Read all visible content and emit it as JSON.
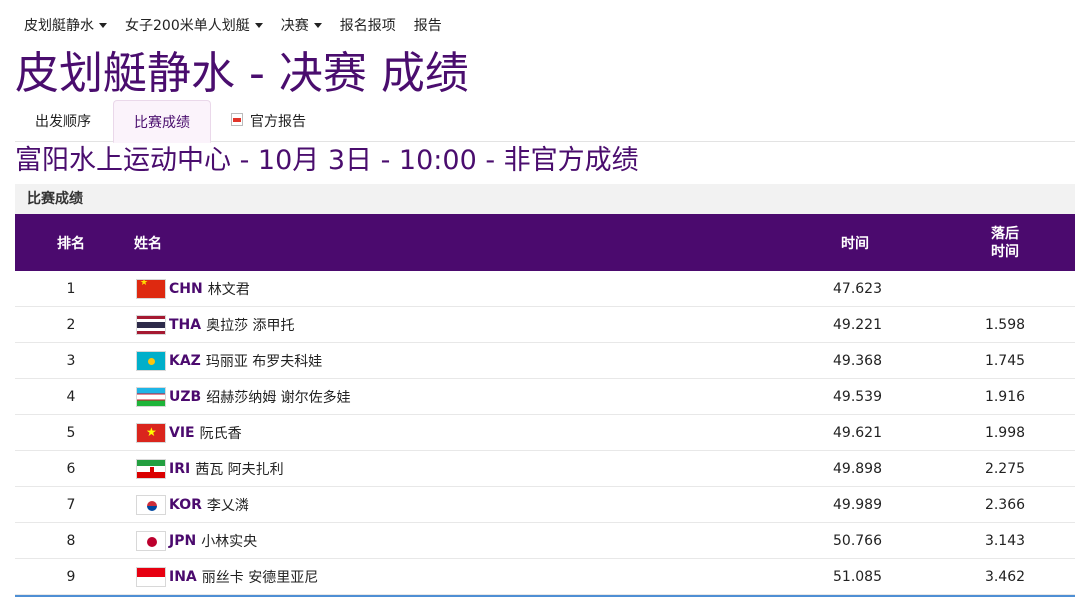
{
  "breadcrumbs": [
    {
      "label": "皮划艇静水",
      "dropdown": true
    },
    {
      "label": "女子200米单人划艇",
      "dropdown": true
    },
    {
      "label": "决赛",
      "dropdown": true
    },
    {
      "label": "报名报项",
      "dropdown": false
    },
    {
      "label": "报告",
      "dropdown": false
    }
  ],
  "page_title": "皮划艇静水 - 决赛 成绩",
  "tabs": {
    "start_list": "出发顺序",
    "results": "比赛成绩",
    "official_report": "官方报告",
    "active": "results"
  },
  "subtitle": "富阳水上运动中心 - 10月 3日 - 10:00 - 非官方成绩",
  "section_label": "比赛成绩",
  "table": {
    "headers": {
      "rank": "排名",
      "name": "姓名",
      "time": "时间",
      "behind_line1": "落后",
      "behind_line2": "时间"
    },
    "rows": [
      {
        "rank": "1",
        "flag": "flag-chn",
        "noc": "CHN",
        "athlete": "林文君",
        "time": "47.623",
        "behind": ""
      },
      {
        "rank": "2",
        "flag": "flag-tha",
        "noc": "THA",
        "athlete": "奥拉莎 添甲托",
        "time": "49.221",
        "behind": "1.598"
      },
      {
        "rank": "3",
        "flag": "flag-kaz",
        "noc": "KAZ",
        "athlete": "玛丽亚 布罗夫科娃",
        "time": "49.368",
        "behind": "1.745"
      },
      {
        "rank": "4",
        "flag": "flag-uzb",
        "noc": "UZB",
        "athlete": "绍赫莎纳姆 谢尔佐多娃",
        "time": "49.539",
        "behind": "1.916"
      },
      {
        "rank": "5",
        "flag": "flag-vie",
        "noc": "VIE",
        "athlete": "阮氏香",
        "time": "49.621",
        "behind": "1.998"
      },
      {
        "rank": "6",
        "flag": "flag-iri",
        "noc": "IRI",
        "athlete": "茜瓦 阿夫扎利",
        "time": "49.898",
        "behind": "2.275"
      },
      {
        "rank": "7",
        "flag": "flag-kor",
        "noc": "KOR",
        "athlete": "李乂潾",
        "time": "49.989",
        "behind": "2.366"
      },
      {
        "rank": "8",
        "flag": "flag-jpn",
        "noc": "JPN",
        "athlete": "小林实央",
        "time": "50.766",
        "behind": "3.143"
      },
      {
        "rank": "9",
        "flag": "flag-ina",
        "noc": "INA",
        "athlete": "丽丝卡 安德里亚尼",
        "time": "51.085",
        "behind": "3.462"
      }
    ]
  },
  "colors": {
    "header_bg": "#4b0a6e",
    "title": "#4a0d6e",
    "accent_line": "#4e8fd4"
  }
}
